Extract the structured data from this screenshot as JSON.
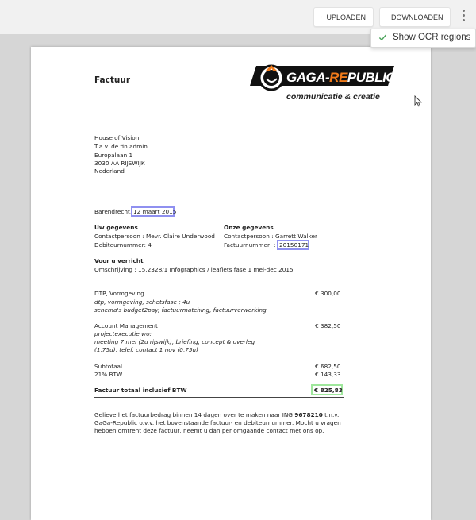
{
  "toolbar": {
    "upload_label": "UPLOADEN",
    "download_label": "DOWNLOADEN",
    "ocr_toggle_label": "Show OCR regions"
  },
  "colors": {
    "ocr_region": "#8f90f0",
    "ocr_region_total": "#9fe79c",
    "check": "#49a35a",
    "logo_orange": "#f07a1a"
  },
  "invoice": {
    "title": "Factuur",
    "logo": {
      "brand_main": "GAGA-",
      "brand_accent": "RE",
      "brand_end": "PUBLIC",
      "tagline": "communicatie & creatie"
    },
    "recipient": [
      "House of Vision",
      "T.a.v. de fin admin",
      "Europalaan 1",
      "3030 AA  RIJSWIJK",
      "Nederland"
    ],
    "date_place": "Barendrecht,",
    "date": "12 maart 2015",
    "uw_gegevens": {
      "heading": "Uw gegevens",
      "contact": "Contactpersoon   : Mevr. Claire Underwood",
      "debiteur": "Debiteurnummer: 4"
    },
    "onze_gegevens": {
      "heading": "Onze gegevens",
      "contact": "Contactpersoon     : Garrett Walker",
      "factuur_label": "Factuurnummer",
      "factuur_sep": ":",
      "factuur_nr": "20150171"
    },
    "verricht": {
      "heading": "Voor u verricht",
      "omschrijving": "Omschrijving        : 15.2328/1 Infographics / leaflets fase 1 mei-dec 2015"
    },
    "items": [
      {
        "title": "DTP, Vormgeving",
        "lines": [
          "dtp, vormgeving, schetsfase ; 4u",
          "schema's budget2pay, factuurmatching, factuurverwerking"
        ],
        "amount": "€ 300,00"
      },
      {
        "title": "Account Management",
        "lines": [
          "projectexecutie wo:",
          "meeting 7 mei (2u rijswijk), briefing, concept & overleg",
          "(1,75u), telef. contact 1 nov (0,75u)"
        ],
        "amount": "€ 382,50"
      }
    ],
    "subtotal_label": "Subtotaal",
    "subtotal": "€ 682,50",
    "btw_label": "21% BTW",
    "btw": "€ 143,33",
    "total_label": "Factuur totaal inclusief BTW",
    "total": "€  825,83",
    "footer": {
      "l1a": "Gelieve het factuurbedrag binnen 14 dagen over te maken naar ING ",
      "iban": "9678210",
      "l1b": " t.n.v.",
      "l2": "GaGa-Republic o.v.v. het bovenstaande factuur- en debiteurnummer. Mocht u vragen",
      "l3": "hebben omtrent deze factuur, neemt u dan per omgaande contact met ons op."
    }
  }
}
